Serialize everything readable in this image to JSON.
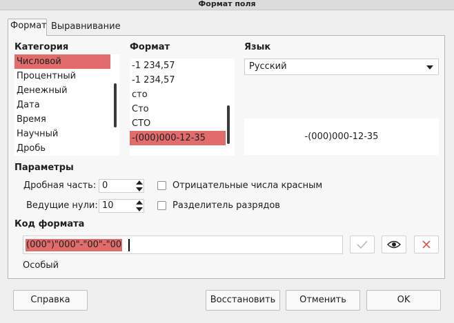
{
  "window": {
    "title": "Формат поля"
  },
  "tabs": [
    {
      "label": "Формат",
      "active": true
    },
    {
      "label": "Выравнивание",
      "active": false
    }
  ],
  "category": {
    "heading": "Категория",
    "items": [
      "Числовой",
      "Процентный",
      "Денежный",
      "Дата",
      "Время",
      "Научный",
      "Дробь"
    ],
    "selected": "Числовой"
  },
  "format": {
    "heading": "Формат",
    "items": [
      "-1 234,57",
      "-1 234,57",
      "сто",
      "Сто",
      "СТО",
      "-(000)000-12-35"
    ],
    "selected": "-(000)000-12-35"
  },
  "language": {
    "heading": "Язык",
    "value": "Русский",
    "preview": "-(000)000-12-35"
  },
  "params": {
    "heading": "Параметры",
    "decimal_label": "Дробная часть:",
    "decimal_value": "0",
    "leading_label": "Ведущие нули:",
    "leading_value": "10",
    "negative_red_label": "Отрицательные числа красным",
    "negative_red_checked": false,
    "thousands_sep_label": "Разделитель разрядов",
    "thousands_sep_checked": false
  },
  "format_code": {
    "heading": "Код формата",
    "value": "(000\")\"000\"-\"00\"-\"00",
    "status": "Особый",
    "icons": [
      "checkmark-icon",
      "eye-icon",
      "close-icon"
    ]
  },
  "buttons": {
    "help": "Справка",
    "reset": "Восстановить",
    "cancel": "Отменить",
    "ok": "OK"
  },
  "colors": {
    "selection": "#e06c6c",
    "delete_icon": "#d9534f"
  }
}
